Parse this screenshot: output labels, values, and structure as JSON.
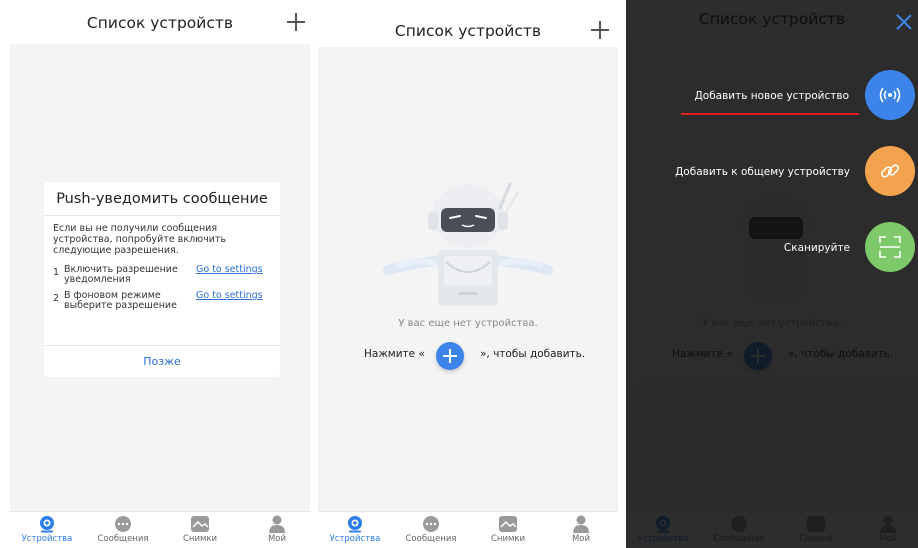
{
  "header": {
    "title": "Список устройств"
  },
  "tabs": [
    {
      "id": "devices",
      "label": "Устройства"
    },
    {
      "id": "messages",
      "label": "Сообщения"
    },
    {
      "id": "snapshots",
      "label": "Снимки"
    },
    {
      "id": "mine",
      "label": "Мой"
    }
  ],
  "dialog": {
    "title": "Push-уведомить сообщение",
    "body": "Если вы не получили сообщения устройства, попробуйте включить следующие разрешения.",
    "items": [
      {
        "num": "1",
        "text": "Включить разрешение уведомления",
        "link": "Go to settings"
      },
      {
        "num": "2",
        "text": "В фоновом режиме выберите разрешение",
        "link": "Go to settings"
      }
    ],
    "later": "Позже"
  },
  "empty_state": {
    "message": "У вас еще нет устройства.",
    "press_prefix": "Нажмите «",
    "press_suffix": "», чтобы добавить."
  },
  "add_menu": {
    "items": [
      {
        "label": "Добавить новое устройство",
        "icon": "wireless-signal-icon",
        "color": "#3d84ea"
      },
      {
        "label": "Добавить к общему устройству",
        "icon": "link-icon",
        "color": "#f3a24e"
      },
      {
        "label": "Сканируйте",
        "icon": "scan-icon",
        "color": "#7ec96a"
      }
    ]
  },
  "colors": {
    "accent": "#2b7de9",
    "link": "#2b6fd6",
    "highlight_underline": "#e02020"
  }
}
